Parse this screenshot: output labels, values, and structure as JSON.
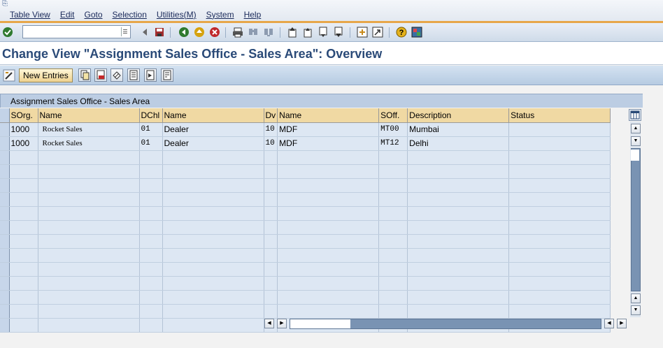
{
  "menu": {
    "items": [
      "Table View",
      "Edit",
      "Goto",
      "Selection",
      "Utilities(M)",
      "System",
      "Help"
    ]
  },
  "toolbar": {
    "command_value": "",
    "icons": [
      "enter-icon",
      "back-icon",
      "save-icon",
      "back-green-icon",
      "exit-icon",
      "cancel-icon",
      "print-icon",
      "find-icon",
      "find-next-icon",
      "first-page-icon",
      "previous-page-icon",
      "next-page-icon",
      "last-page-icon",
      "create-session-icon",
      "shortcut-icon",
      "help-icon",
      "layout-menu-icon"
    ]
  },
  "title": "Change View \"Assignment Sales Office - Sales Area\": Overview",
  "app_toolbar": {
    "new_entries_label": "New Entries",
    "icons": [
      "display-change-icon",
      "copy-as-icon",
      "delete-icon",
      "undo-change-icon",
      "select-all-icon",
      "select-block-icon",
      "deselect-all-icon"
    ]
  },
  "table": {
    "title": "Assignment Sales Office - Sales Area",
    "columns": [
      "SOrg.",
      "Name",
      "DChl",
      "Name",
      "Dv",
      "Name",
      "SOff.",
      "Description",
      "Status"
    ],
    "rows": [
      [
        "1000",
        "Rocket Sales",
        "01",
        "Dealer",
        "10",
        "MDF",
        "MT00",
        "Mumbai",
        ""
      ],
      [
        "1000",
        "Rocket Sales",
        "01",
        "Dealer",
        "10",
        "MDF",
        "MT12",
        "Delhi",
        ""
      ]
    ],
    "empty_rows": 13
  },
  "colors": {
    "accent_orange": "#e7a74a",
    "title_blue": "#2a4a78",
    "header_beige": "#f0d9a3",
    "row_blue": "#dde7f3"
  }
}
